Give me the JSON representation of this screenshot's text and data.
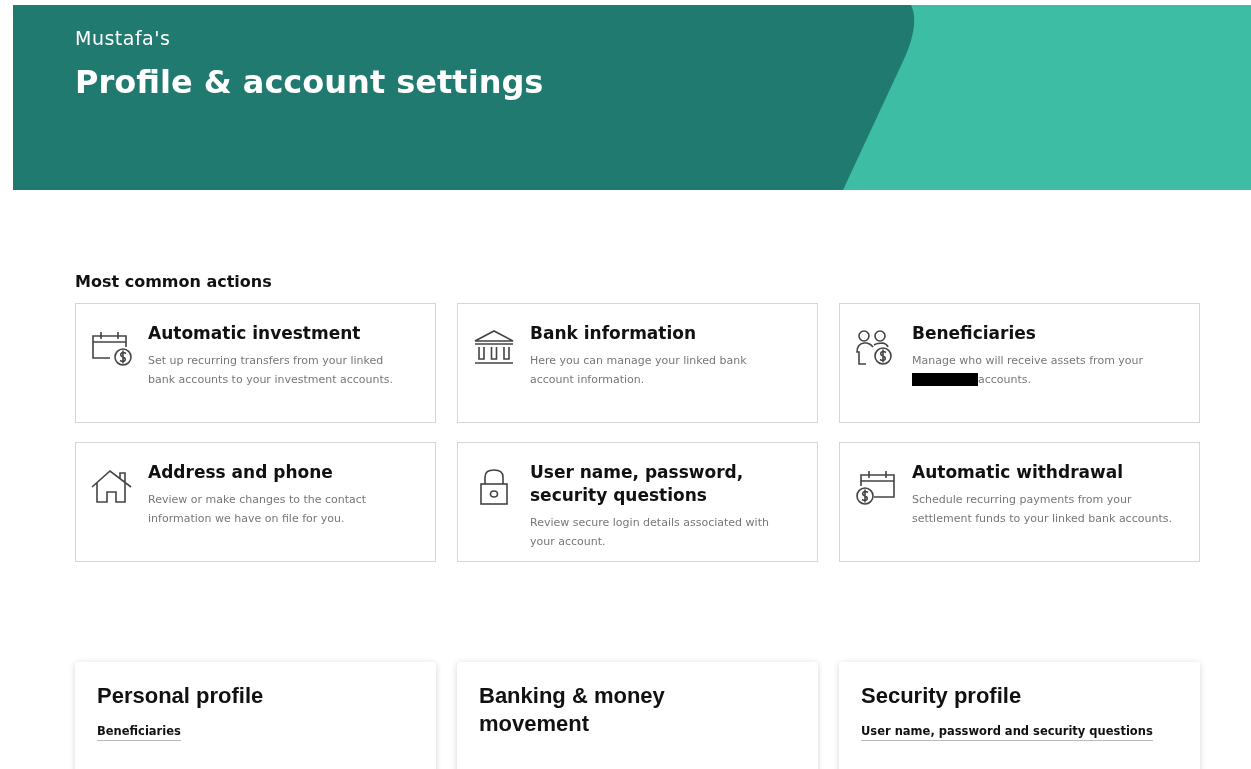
{
  "header": {
    "owner": "Mustafa's",
    "title": "Profile & account settings"
  },
  "common_actions": {
    "heading": "Most common actions",
    "cards": [
      {
        "kind": "calendar-dollar",
        "title": "Automatic investment",
        "desc": "Set up recurring transfers from your linked bank accounts to your investment accounts."
      },
      {
        "kind": "bank",
        "title": "Bank information",
        "desc": "Here you can manage your linked bank account information."
      },
      {
        "kind": "people-dollar",
        "title": "Beneficiaries",
        "desc": "Manage who will receive assets from your",
        "redacted": true,
        "desc_after": "accounts."
      },
      {
        "kind": "house",
        "title": "Address and phone",
        "desc": "Review or make changes to the contact information we have on file for you."
      },
      {
        "kind": "lock",
        "title": "User name, password, security questions",
        "desc": "Review secure login details associated with your account."
      },
      {
        "kind": "dollar-calendar",
        "title": "Automatic withdrawal",
        "desc": "Schedule recurring payments from your settlement funds to your linked bank accounts."
      }
    ]
  },
  "sections": [
    {
      "title": "Personal profile",
      "links": [
        "Beneficiaries"
      ]
    },
    {
      "title": "Banking & money movement"
    },
    {
      "title": "Security profile",
      "links": [
        "User name, password and security questions"
      ]
    }
  ]
}
